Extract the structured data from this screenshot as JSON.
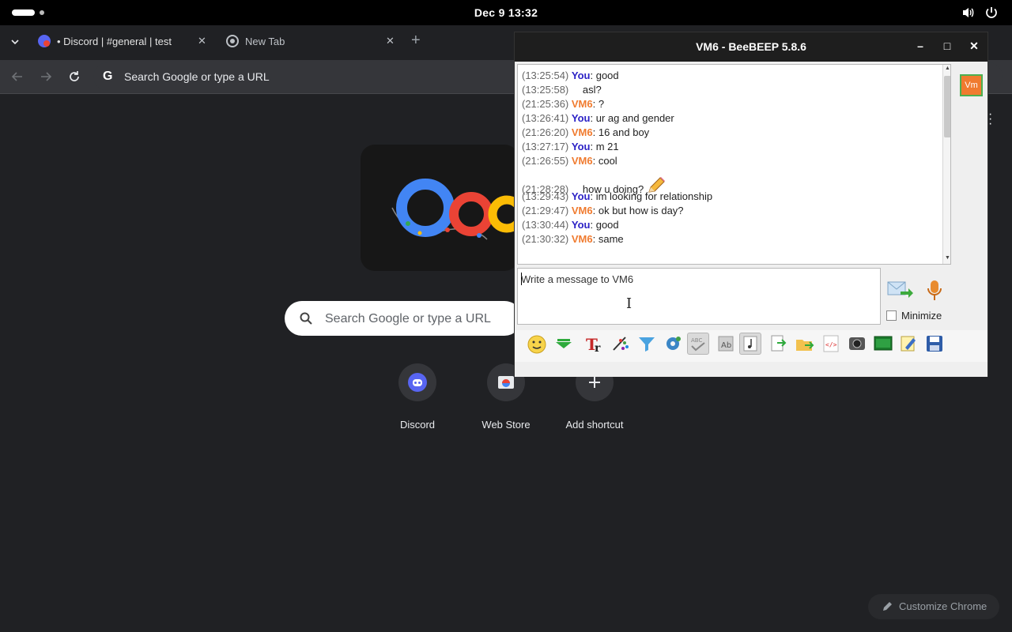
{
  "system_bar": {
    "clock": "Dec 9  13:32",
    "volume_icon": "volume-icon",
    "power_icon": "power-icon"
  },
  "browser": {
    "tabs": [
      {
        "title": "• Discord | #general | test",
        "icon": "discord-favicon"
      },
      {
        "title": "New Tab",
        "icon": "chrome-favicon"
      }
    ],
    "omnibox": {
      "placeholder": "Search Google or type a URL"
    },
    "ntp": {
      "search_placeholder": "Search Google or type a URL",
      "shortcuts": [
        {
          "label": "Discord",
          "icon": "discord-icon"
        },
        {
          "label": "Web Store",
          "icon": "web-store-icon"
        },
        {
          "label": "Add shortcut",
          "icon": "plus-icon"
        }
      ],
      "customize_label": "Customize Chrome"
    }
  },
  "beebeep": {
    "title": "VM6 - BeeBEEP 5.8.6",
    "avatar_text": "Vm",
    "messages": [
      {
        "time": "(13:25:54)",
        "sender": "You",
        "text": ": good"
      },
      {
        "time": "(13:25:58)",
        "sender": "",
        "text": "asl?"
      },
      {
        "time": "(21:25:36)",
        "sender": "VM6",
        "text": ": ?"
      },
      {
        "time": "(13:26:41)",
        "sender": "You",
        "text": ": ur ag and gender"
      },
      {
        "time": "(21:26:20)",
        "sender": "VM6",
        "text": ": 16 and boy"
      },
      {
        "time": "(13:27:17)",
        "sender": "You",
        "text": ": m 21"
      },
      {
        "time": "(21:26:55)",
        "sender": "VM6",
        "text": ": cool"
      },
      {
        "time": "(21:28:28)",
        "sender": "",
        "text": "how u doing?"
      },
      {
        "time": "(13:29:43)",
        "sender": "You",
        "text": ": im looking for relationship"
      },
      {
        "time": "(21:29:47)",
        "sender": "VM6",
        "text": ": ok but how is day?"
      },
      {
        "time": "(13:30:44)",
        "sender": "You",
        "text": ": good"
      },
      {
        "time": "(21:30:32)",
        "sender": "VM6",
        "text": ": same"
      }
    ],
    "input_placeholder": "Write a message to VM6",
    "minimize_label": "Minimize",
    "colors": {
      "you": "#2c22c6",
      "vm6": "#f07b2f"
    }
  }
}
